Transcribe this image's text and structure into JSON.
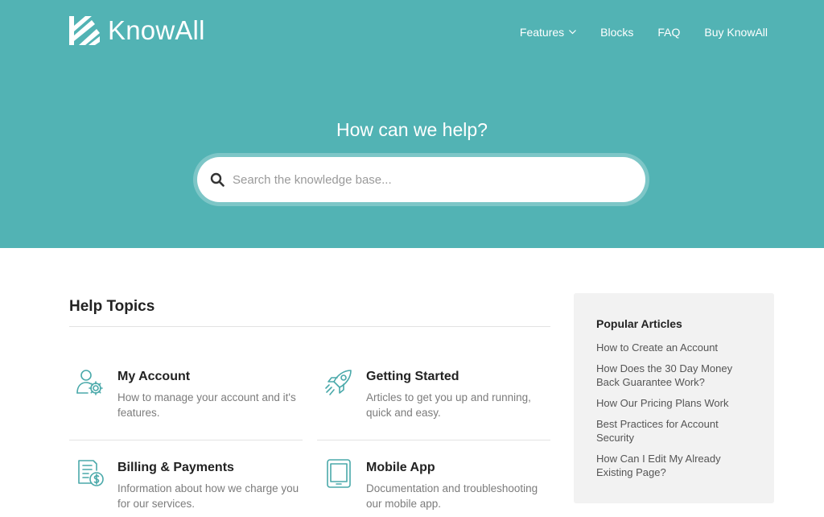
{
  "brand": {
    "name": "KnowAll"
  },
  "nav": {
    "items": [
      {
        "label": "Features",
        "has_dropdown": true
      },
      {
        "label": "Blocks"
      },
      {
        "label": "FAQ"
      },
      {
        "label": "Buy KnowAll"
      }
    ]
  },
  "hero": {
    "title": "How can we help?",
    "search_placeholder": "Search the knowledge base...",
    "search_value": ""
  },
  "help_topics": {
    "title": "Help Topics",
    "topics": [
      {
        "title": "My Account",
        "description": "How to manage your account and it's features.",
        "icon": "user-gear-icon"
      },
      {
        "title": "Getting Started",
        "description": "Articles to get you up and running, quick and easy.",
        "icon": "rocket-icon"
      },
      {
        "title": "Billing & Payments",
        "description": "Information about how we charge you for our services.",
        "icon": "billing-icon"
      },
      {
        "title": "Mobile App",
        "description": "Documentation and troubleshooting our mobile app.",
        "icon": "tablet-icon"
      }
    ]
  },
  "sidebar": {
    "title": "Popular Articles",
    "links": [
      "How to Create an Account",
      "How Does the 30 Day Money Back Guarantee Work?",
      "How Our Pricing Plans Work",
      "Best Practices for Account Security",
      "How Can I Edit My Already Existing Page?"
    ]
  },
  "colors": {
    "hero_bg": "#52b3b4",
    "accent": "#4aa9aa",
    "sidebar_bg": "#f2f2f2",
    "text_dark": "#222222",
    "text_muted": "#7c7c7c"
  }
}
